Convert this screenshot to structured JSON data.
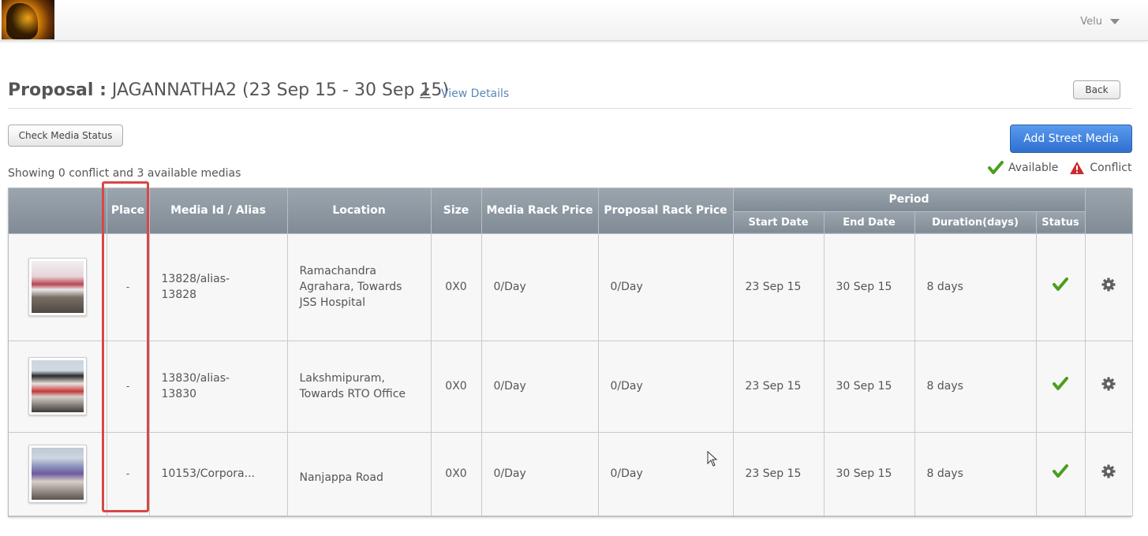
{
  "header": {
    "user_name": "Velu",
    "user_caret_icon": "chevron-down-icon",
    "logo_icon": "brand-logo"
  },
  "proposal": {
    "label": "Proposal :",
    "name": "JAGANNATHA2 (23 Sep 15 - 30 Sep 15)",
    "edit_icon": "pencil-icon",
    "view_details_label": "View Details",
    "back_label": "Back"
  },
  "actions": {
    "check_media_status_label": "Check Media Status",
    "add_street_media_label": "Add Street Media"
  },
  "summary_text": "Showing 0 conflict and 3 available medias",
  "legend": {
    "available_label": "Available",
    "conflict_label": "Conflict",
    "available_color": "#4a9e1e",
    "conflict_color": "#cc2b2b"
  },
  "table": {
    "headers": {
      "place": "Place",
      "media_id": "Media Id / Alias",
      "location": "Location",
      "size": "Size",
      "media_rack_price": "Media Rack Price",
      "proposal_rack_price": "Proposal Rack Price",
      "period": "Period",
      "start_date": "Start Date",
      "end_date": "End Date",
      "duration": "Duration(days)",
      "status": "Status"
    },
    "rows": [
      {
        "place": "-",
        "media_id": "13828/alias-\n13828",
        "location": "Ramachandra Agrahara, Towards JSS Hospital",
        "size": "0X0",
        "media_rack_price": "0/Day",
        "proposal_rack_price": "0/Day",
        "start_date": "23 Sep 15",
        "end_date": "30 Sep 15",
        "duration": "8 days",
        "status": "available"
      },
      {
        "place": "-",
        "media_id": "13830/alias-\n13830",
        "location": "Lakshmipuram, Towards RTO Office",
        "size": "0X0",
        "media_rack_price": "0/Day",
        "proposal_rack_price": "0/Day",
        "start_date": "23 Sep 15",
        "end_date": "30 Sep 15",
        "duration": "8 days",
        "status": "available"
      },
      {
        "place": "-",
        "media_id": "10153/Corpora...",
        "location": "Nanjappa Road",
        "size": "0X0",
        "media_rack_price": "0/Day",
        "proposal_rack_price": "0/Day",
        "start_date": "23 Sep 15",
        "end_date": "30 Sep 15",
        "duration": "8 days",
        "status": "available"
      }
    ]
  },
  "accent_color": "#3a7bd5",
  "highlight_color": "#d64848"
}
